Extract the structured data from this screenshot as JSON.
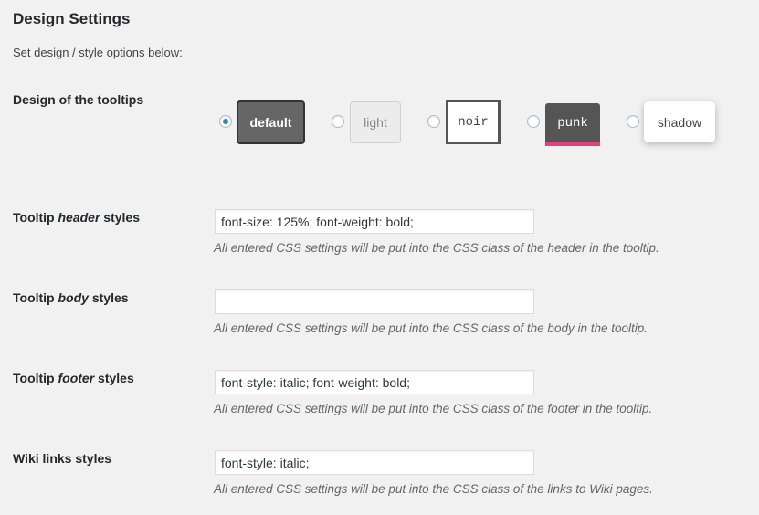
{
  "page": {
    "title": "Design Settings",
    "description": "Set design / style options below:"
  },
  "design": {
    "label": "Design of the tooltips",
    "selected": "default",
    "options": [
      {
        "label": "default"
      },
      {
        "label": "light"
      },
      {
        "label": "noir"
      },
      {
        "label": "punk"
      },
      {
        "label": "shadow"
      }
    ],
    "colors": {
      "accent": "#1e8cbe",
      "punk_border": "#e2407a"
    }
  },
  "header_styles": {
    "label_pre": "Tooltip ",
    "label_em": "header",
    "label_post": " styles",
    "value": "font-size: 125%; font-weight: bold;",
    "help": "All entered CSS settings will be put into the CSS class of the header in the tooltip."
  },
  "body_styles": {
    "label_pre": "Tooltip ",
    "label_em": "body",
    "label_post": " styles",
    "value": "",
    "help": "All entered CSS settings will be put into the CSS class of the body in the tooltip."
  },
  "footer_styles": {
    "label_pre": "Tooltip ",
    "label_em": "footer",
    "label_post": " styles",
    "value": "font-style: italic; font-weight: bold;",
    "help": "All entered CSS settings will be put into the CSS class of the footer in the tooltip."
  },
  "wiki_styles": {
    "label": "Wiki links styles",
    "value": "font-style: italic;",
    "help": "All entered CSS settings will be put into the CSS class of the links to Wiki pages."
  }
}
